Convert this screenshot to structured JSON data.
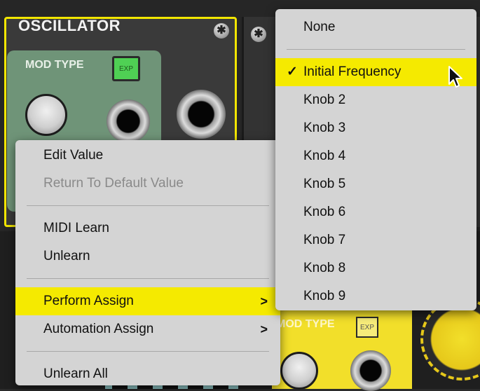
{
  "panel": {
    "title": "OSCILLATOR",
    "mod_type_label": "MOD TYPE",
    "exp_label": "EXP"
  },
  "lower_panel": {
    "mod_type_label": "MOD TYPE",
    "exp_label": "EXP"
  },
  "context_menu": {
    "items": [
      {
        "label": "Edit Value"
      },
      {
        "label": "Return To Default Value"
      },
      {
        "label": "MIDI Learn"
      },
      {
        "label": "Unlearn"
      },
      {
        "label": "Perform Assign",
        "arrow": ">"
      },
      {
        "label": "Automation Assign",
        "arrow": ">"
      },
      {
        "label": "Unlearn All"
      }
    ]
  },
  "submenu": {
    "checkmark": "✓",
    "items": [
      {
        "label": "None"
      },
      {
        "label": "Initial Frequency"
      },
      {
        "label": "Knob 2"
      },
      {
        "label": "Knob 3"
      },
      {
        "label": "Knob 4"
      },
      {
        "label": "Knob 5"
      },
      {
        "label": "Knob 6"
      },
      {
        "label": "Knob 7"
      },
      {
        "label": "Knob 8"
      },
      {
        "label": "Knob 9"
      }
    ]
  },
  "colors": {
    "highlight": "#f5ea00",
    "menu_bg": "#d4d4d4",
    "panel_border": "#f2e600"
  }
}
